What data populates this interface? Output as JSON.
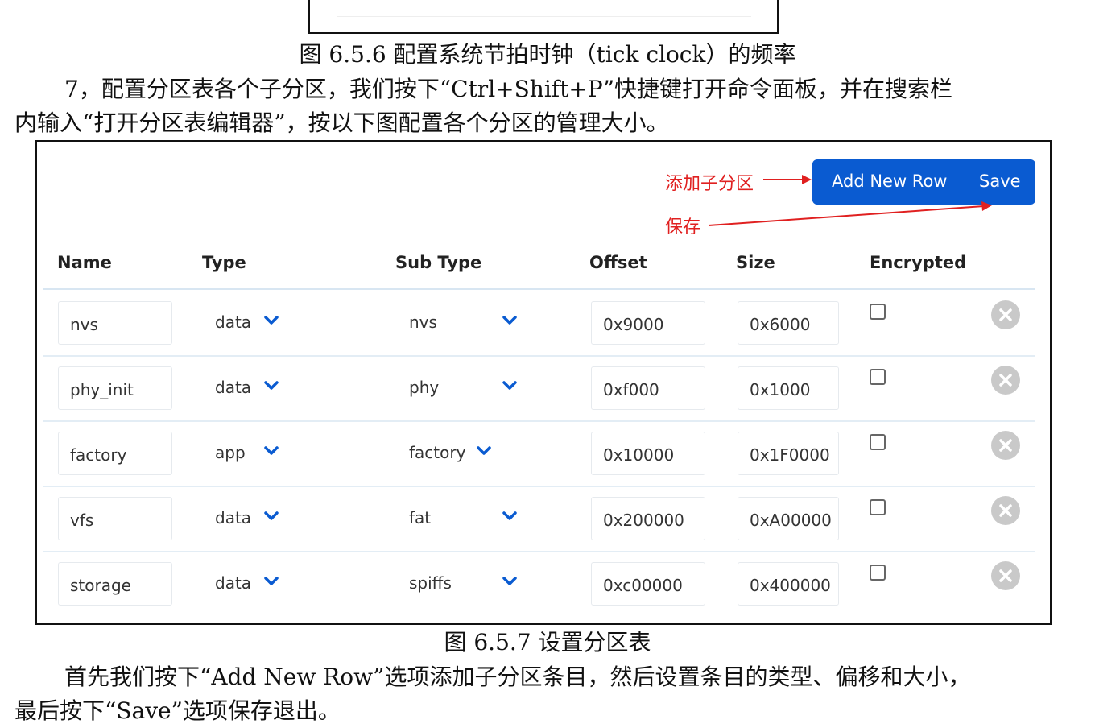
{
  "document": {
    "prev_caption": "图 6.5.6 配置系统节拍时钟（tick clock）的频率",
    "para1_line1": "7，配置分区表各个子分区，我们按下“Ctrl+Shift+P”快捷键打开命令面板，并在搜索栏",
    "para1_line2": "内输入“打开分区表编辑器”，按以下图配置各个分区的管理大小。",
    "figure_caption": "图 6.5.7 设置分区表",
    "para2_line1": "首先我们按下“Add New Row”选项添加子分区条目，然后设置条目的类型、偏移和大小，",
    "para2_line2": "最后按下“Save”选项保存退出。"
  },
  "editor": {
    "add_button": "Add New Row",
    "save_button": "Save",
    "annotation_add": "添加子分区",
    "annotation_save": "保存",
    "headers": [
      "Name",
      "Type",
      "Sub Type",
      "Offset",
      "Size",
      "Encrypted"
    ],
    "rows": [
      {
        "name": "nvs",
        "type": "data",
        "subtype": "nvs",
        "offset": "0x9000",
        "size": "0x6000",
        "encrypted": false
      },
      {
        "name": "phy_init",
        "type": "data",
        "subtype": "phy",
        "offset": "0xf000",
        "size": "0x1000",
        "encrypted": false
      },
      {
        "name": "factory",
        "type": "app",
        "subtype": "factory",
        "offset": "0x10000",
        "size": "0x1F0000",
        "encrypted": false
      },
      {
        "name": "vfs",
        "type": "data",
        "subtype": "fat",
        "offset": "0x200000",
        "size": "0xA00000",
        "encrypted": false
      },
      {
        "name": "storage",
        "type": "data",
        "subtype": "spiffs",
        "offset": "0xc00000",
        "size": "0x400000",
        "encrypted": false
      }
    ]
  },
  "colors": {
    "accent": "#0a5bd1",
    "annotation": "#e02020",
    "chevron": "#0a5bd1",
    "delete": "#c9c9c9"
  },
  "icons": {
    "dropdown": "chevron-down-icon",
    "delete": "close-circle-icon",
    "checkbox": "checkbox-icon"
  }
}
